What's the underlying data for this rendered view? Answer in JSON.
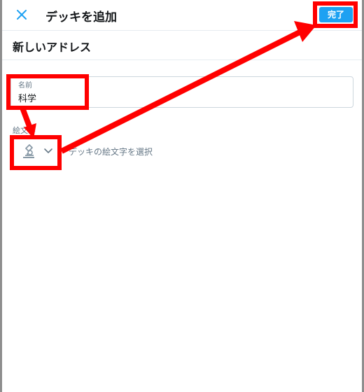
{
  "header": {
    "title": "デッキを追加",
    "done_label": "完了",
    "close_icon": "close-icon"
  },
  "section": {
    "title": "新しいアドレス"
  },
  "name_field": {
    "label": "名前",
    "value": "科学"
  },
  "emoji": {
    "label": "絵文字",
    "selected_icon": "microscope-icon",
    "dropdown_icon": "chevron-down-icon",
    "hint": "デッキの絵文字を選択"
  },
  "colors": {
    "accent": "#1da1f2",
    "annotation": "#ff0000"
  }
}
